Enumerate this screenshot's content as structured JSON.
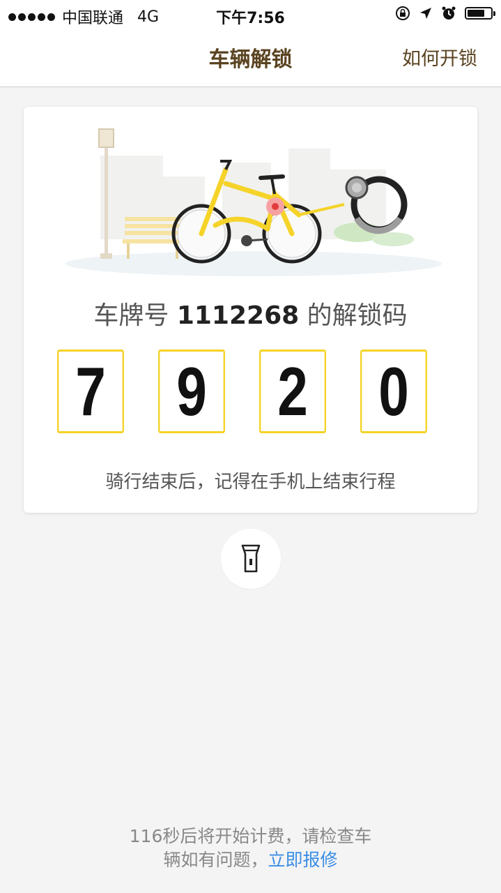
{
  "status_bar": {
    "carrier": "中国联通",
    "network": "4G",
    "time": "下午7:56",
    "battery_level": 0.75
  },
  "nav": {
    "title": "车辆解锁",
    "right_action": "如何开锁"
  },
  "card": {
    "plate_prefix": "车牌号",
    "plate_number": "1112268",
    "plate_suffix": "的解锁码",
    "code_digits": [
      "7",
      "9",
      "2",
      "0"
    ],
    "hint": "骑行结束后，记得在手机上结束行程"
  },
  "flashlight": {
    "icon": "flashlight-icon"
  },
  "footer": {
    "line1": "116秒后将开始计费，请检查车",
    "line2_prefix": "辆如有问题，",
    "report_link": "立即报修"
  },
  "colors": {
    "accent_yellow": "#f5d328",
    "brown_text": "#5a4320",
    "link_blue": "#3a8ee6",
    "background": "#f4f4f4"
  }
}
